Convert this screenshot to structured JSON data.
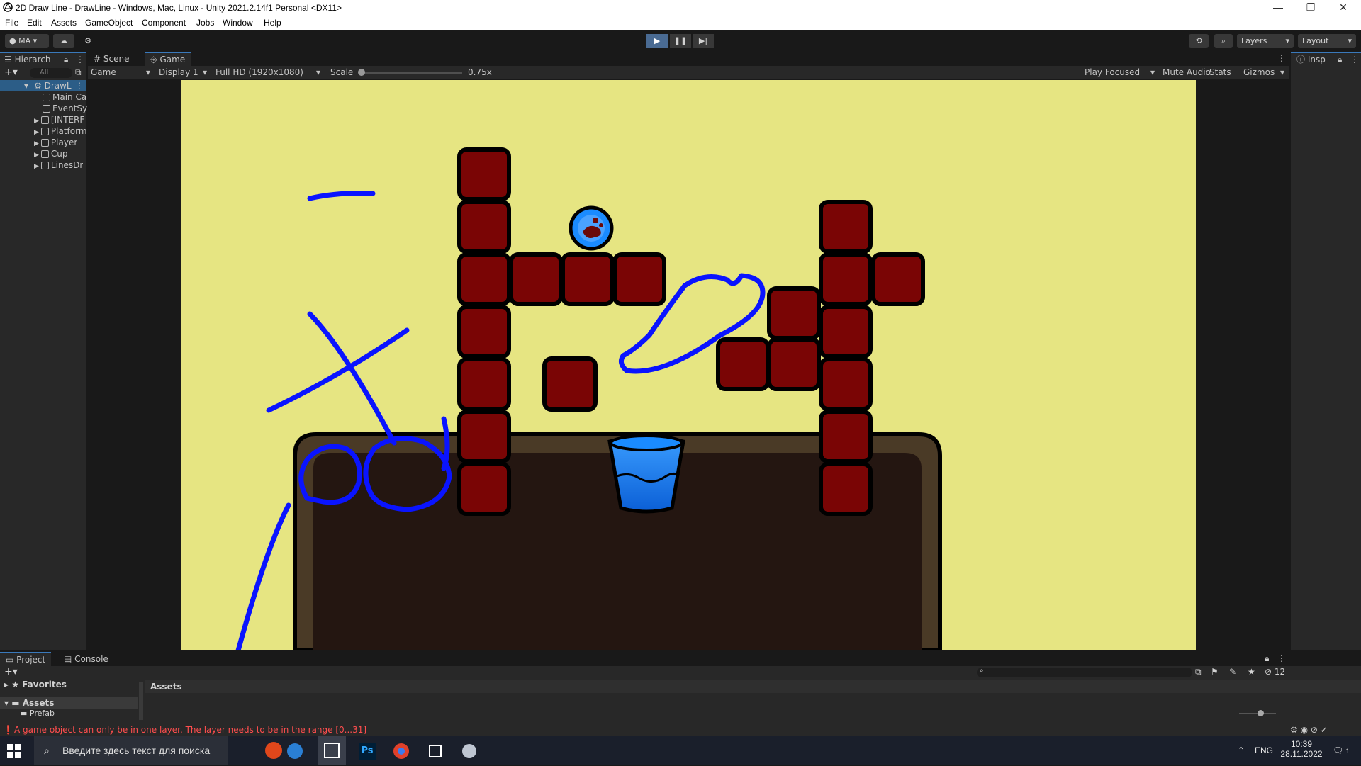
{
  "window": {
    "title": "2D Draw Line - DrawLine - Windows, Mac, Linux - Unity 2021.2.14f1 Personal <DX11>",
    "controls": [
      "—",
      "❐",
      "✕"
    ]
  },
  "menu": [
    "File",
    "Edit",
    "Assets",
    "GameObject",
    "Component",
    "Jobs",
    "Window",
    "Help"
  ],
  "toolbar": {
    "account": "MA",
    "layers_label": "Layers",
    "layout_label": "Layout"
  },
  "hierarchy": {
    "tab_label": "Hierarch",
    "search_placeholder": "All",
    "scene_name": "DrawL",
    "items": [
      "Main Ca",
      "EventSy",
      "[INTERF",
      "Platform",
      "Player",
      "Cup",
      "LinesDr"
    ]
  },
  "center_tabs": {
    "scene": "Scene",
    "game": "Game"
  },
  "game_toolbar": {
    "mode": "Game",
    "display": "Display 1",
    "resolution": "Full HD (1920x1080)",
    "scale_label": "Scale",
    "scale_value": "0.75x",
    "play_focused": "Play Focused",
    "mute_audio": "Mute Audio",
    "stats": "Stats",
    "gizmos": "Gizmos"
  },
  "inspector": {
    "tab_label": "Insp"
  },
  "bottom_tabs": {
    "project": "Project",
    "console": "Console"
  },
  "project": {
    "favorites": "Favorites",
    "assets_root": "Assets",
    "assets_child": "Prefab",
    "breadcrumb": "Assets",
    "hidden_count": "12"
  },
  "status": {
    "error_message": "A game object can only be in one layer. The layer needs to be in the range [0...31]"
  },
  "taskbar": {
    "search_placeholder": "Введите здесь текст для поиска",
    "lang": "ENG",
    "time": "10:39",
    "date": "28.11.2022",
    "notif_count": "1"
  },
  "colors": {
    "game_bg": "#e6e582",
    "block": "#7a0505",
    "line": "#0a14ff",
    "platform": "#241611",
    "accent": "#3a79bb",
    "error": "#ff4e4e"
  }
}
